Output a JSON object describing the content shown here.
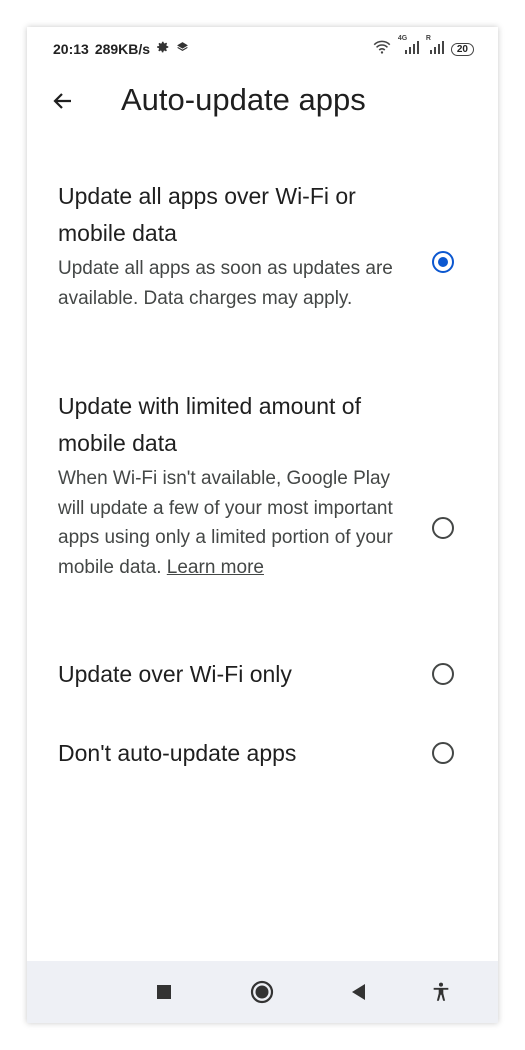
{
  "status_bar": {
    "time": "20:13",
    "speed": "289KB/s",
    "network_label": "4G",
    "signal_label": "R",
    "battery": "20"
  },
  "app_bar": {
    "title": "Auto-update apps"
  },
  "options": [
    {
      "title": "Update all apps over Wi-Fi or mobile data",
      "description": "Update all apps as soon as updates are available. Data charges may apply.",
      "selected": true
    },
    {
      "title": "Update with limited amount of mobile data",
      "description": "When Wi-Fi isn't available, Google Play will update a few of your most important apps using only a limited portion of your mobile data.",
      "link": "Learn more",
      "selected": false
    },
    {
      "title": "Update over Wi-Fi only",
      "selected": false
    },
    {
      "title": "Don't auto-update apps",
      "selected": false
    }
  ],
  "colors": {
    "accent": "#0b57d0",
    "text_primary": "#1f1f1f",
    "text_secondary": "#444746",
    "nav_background": "#eef0f5"
  },
  "icons": {
    "back": "arrow-left-icon",
    "nav_recents": "square-icon",
    "nav_home": "circle-icon",
    "nav_back": "triangle-left-icon",
    "nav_accessibility": "accessibility-icon"
  }
}
